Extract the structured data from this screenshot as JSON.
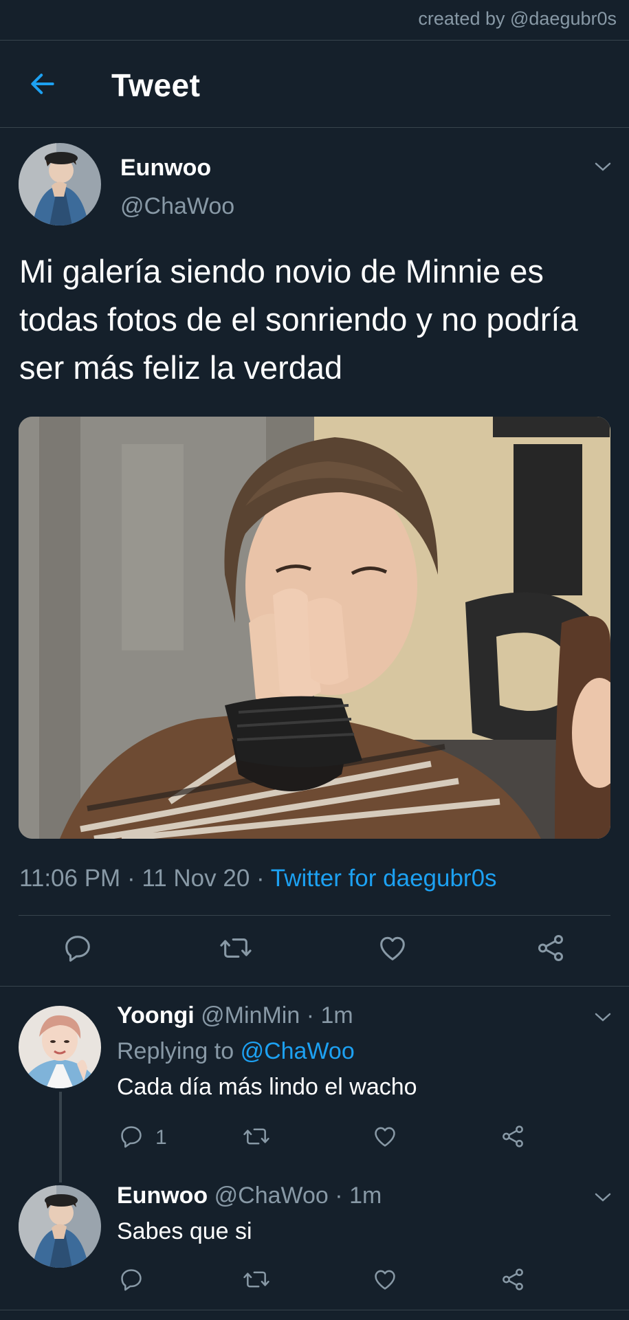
{
  "watermark": "created by @daegubr0s",
  "header": {
    "title": "Tweet"
  },
  "main_tweet": {
    "name": "Eunwoo",
    "handle": "@ChaWoo",
    "text": "Mi galería siendo novio de Minnie es todas fotos de el sonriendo y no podría ser más feliz la verdad",
    "time": "11:06 PM",
    "date": "11 Nov 20",
    "source": "Twitter for daegubr0s",
    "sep": "·"
  },
  "replies": [
    {
      "name": "Yoongi",
      "handle": "@MinMin",
      "time": "1m",
      "replying_label": "Replying to",
      "replying_to": "@ChaWoo",
      "text": "Cada día más lindo el wacho",
      "reply_count": "1"
    },
    {
      "name": "Eunwoo",
      "handle": "@ChaWoo",
      "time": "1m",
      "text": "Sabes que si"
    }
  ],
  "icons": {
    "back": "arrow-left-icon",
    "more": "chevron-down-icon",
    "reply": "speech-bubble-icon",
    "retweet": "retweet-icon",
    "like": "heart-icon",
    "share": "share-icon"
  },
  "colors": {
    "background": "#15202b",
    "accent": "#1da1f2",
    "muted": "#8899a6",
    "divider": "#38444d"
  }
}
